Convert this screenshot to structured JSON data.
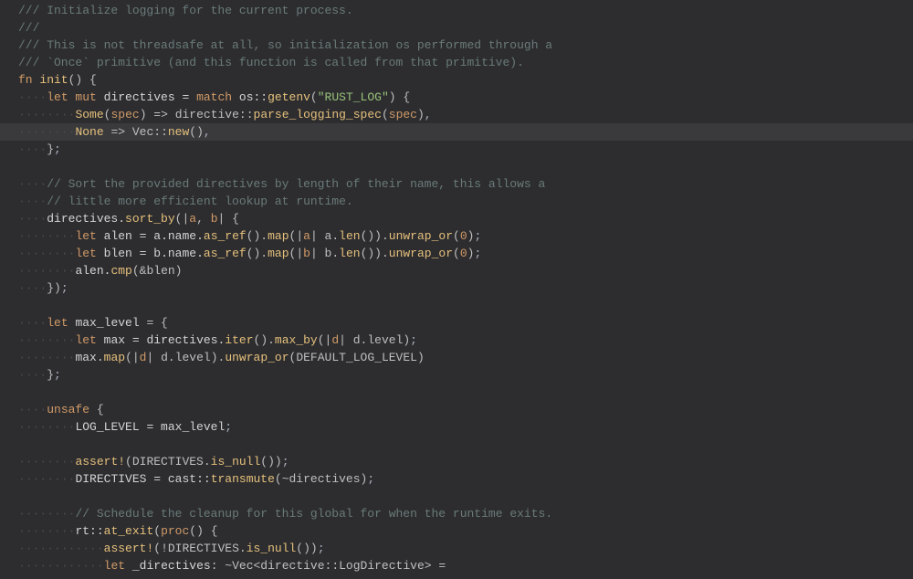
{
  "editor": {
    "lines": [
      {
        "spans": [
          {
            "t": "/// Initialize logging for the current process.",
            "c": "comment"
          }
        ],
        "ind": 0
      },
      {
        "spans": [
          {
            "t": "///",
            "c": "comment"
          }
        ],
        "ind": 0
      },
      {
        "spans": [
          {
            "t": "/// This is not threadsafe at all, so initialization os performed through a",
            "c": "comment"
          }
        ],
        "ind": 0
      },
      {
        "spans": [
          {
            "t": "/// `Once` primitive (and this function is called from that primitive).",
            "c": "comment"
          }
        ],
        "ind": 0
      },
      {
        "spans": [
          {
            "t": "fn ",
            "c": "kw"
          },
          {
            "t": "init",
            "c": "fnname"
          },
          {
            "t": "() {",
            "c": "punc"
          }
        ],
        "ind": 0
      },
      {
        "spans": [
          {
            "t": "let mut ",
            "c": "kw"
          },
          {
            "t": "directives ",
            "c": "ident"
          },
          {
            "t": "= ",
            "c": "op"
          },
          {
            "t": "match ",
            "c": "kw"
          },
          {
            "t": "os::",
            "c": "ident"
          },
          {
            "t": "getenv",
            "c": "fnname"
          },
          {
            "t": "(",
            "c": "punc"
          },
          {
            "t": "\"RUST_LOG\"",
            "c": "str"
          },
          {
            "t": ") {",
            "c": "punc"
          }
        ],
        "ind": 1
      },
      {
        "spans": [
          {
            "t": "Some",
            "c": "fnname"
          },
          {
            "t": "(",
            "c": "punc"
          },
          {
            "t": "spec",
            "c": "param"
          },
          {
            "t": ") => directive::",
            "c": "punc"
          },
          {
            "t": "parse_logging_spec",
            "c": "fnname"
          },
          {
            "t": "(",
            "c": "punc"
          },
          {
            "t": "spec",
            "c": "param"
          },
          {
            "t": ")",
            "c": "punc"
          },
          {
            "t": ",",
            "c": "semi"
          }
        ],
        "ind": 2
      },
      {
        "spans": [
          {
            "t": "None",
            "c": "fnname"
          },
          {
            "t": " => Vec::",
            "c": "punc"
          },
          {
            "t": "new",
            "c": "fnname"
          },
          {
            "t": "()",
            "c": "punc"
          },
          {
            "t": ",",
            "c": "semi"
          }
        ],
        "ind": 2,
        "hl": true
      },
      {
        "spans": [
          {
            "t": "}",
            "c": "punc"
          },
          {
            "t": ";",
            "c": "semi"
          }
        ],
        "ind": 1
      },
      {
        "spans": [],
        "ind": 0
      },
      {
        "spans": [
          {
            "t": "// Sort the provided directives by length of their name, this allows a",
            "c": "comment"
          }
        ],
        "ind": 1
      },
      {
        "spans": [
          {
            "t": "// little more efficient lookup at runtime.",
            "c": "comment"
          }
        ],
        "ind": 1
      },
      {
        "spans": [
          {
            "t": "directives.",
            "c": "ident"
          },
          {
            "t": "sort_by",
            "c": "fnname"
          },
          {
            "t": "(|",
            "c": "punc"
          },
          {
            "t": "a",
            "c": "param"
          },
          {
            "t": ", ",
            "c": "punc"
          },
          {
            "t": "b",
            "c": "param"
          },
          {
            "t": "| {",
            "c": "punc"
          }
        ],
        "ind": 1
      },
      {
        "spans": [
          {
            "t": "let ",
            "c": "kw"
          },
          {
            "t": "alen ",
            "c": "ident"
          },
          {
            "t": "= a.name.",
            "c": "ident"
          },
          {
            "t": "as_ref",
            "c": "fnname"
          },
          {
            "t": "().",
            "c": "punc"
          },
          {
            "t": "map",
            "c": "fnname"
          },
          {
            "t": "(|",
            "c": "punc"
          },
          {
            "t": "a",
            "c": "param"
          },
          {
            "t": "| a.",
            "c": "punc"
          },
          {
            "t": "len",
            "c": "fnname"
          },
          {
            "t": "()).",
            "c": "punc"
          },
          {
            "t": "unwrap_or",
            "c": "fnname"
          },
          {
            "t": "(",
            "c": "punc"
          },
          {
            "t": "0",
            "c": "num"
          },
          {
            "t": ")",
            "c": "punc"
          },
          {
            "t": ";",
            "c": "semi"
          }
        ],
        "ind": 2
      },
      {
        "spans": [
          {
            "t": "let ",
            "c": "kw"
          },
          {
            "t": "blen ",
            "c": "ident"
          },
          {
            "t": "= b.name.",
            "c": "ident"
          },
          {
            "t": "as_ref",
            "c": "fnname"
          },
          {
            "t": "().",
            "c": "punc"
          },
          {
            "t": "map",
            "c": "fnname"
          },
          {
            "t": "(|",
            "c": "punc"
          },
          {
            "t": "b",
            "c": "param"
          },
          {
            "t": "| b.",
            "c": "punc"
          },
          {
            "t": "len",
            "c": "fnname"
          },
          {
            "t": "()).",
            "c": "punc"
          },
          {
            "t": "unwrap_or",
            "c": "fnname"
          },
          {
            "t": "(",
            "c": "punc"
          },
          {
            "t": "0",
            "c": "num"
          },
          {
            "t": ")",
            "c": "punc"
          },
          {
            "t": ";",
            "c": "semi"
          }
        ],
        "ind": 2,
        "caret": 50
      },
      {
        "spans": [
          {
            "t": "alen.",
            "c": "ident"
          },
          {
            "t": "cmp",
            "c": "fnname"
          },
          {
            "t": "(&blen)",
            "c": "punc"
          }
        ],
        "ind": 2
      },
      {
        "spans": [
          {
            "t": "})",
            "c": "punc"
          },
          {
            "t": ";",
            "c": "semi"
          }
        ],
        "ind": 1
      },
      {
        "spans": [],
        "ind": 0
      },
      {
        "spans": [
          {
            "t": "let ",
            "c": "kw"
          },
          {
            "t": "max_level ",
            "c": "ident"
          },
          {
            "t": "= {",
            "c": "punc"
          }
        ],
        "ind": 1
      },
      {
        "spans": [
          {
            "t": "let ",
            "c": "kw"
          },
          {
            "t": "max ",
            "c": "ident"
          },
          {
            "t": "= directives.",
            "c": "ident"
          },
          {
            "t": "iter",
            "c": "fnname"
          },
          {
            "t": "().",
            "c": "punc"
          },
          {
            "t": "max_by",
            "c": "fnname"
          },
          {
            "t": "(|",
            "c": "punc"
          },
          {
            "t": "d",
            "c": "param"
          },
          {
            "t": "| d.level)",
            "c": "punc"
          },
          {
            "t": ";",
            "c": "semi"
          }
        ],
        "ind": 2
      },
      {
        "spans": [
          {
            "t": "max.",
            "c": "ident"
          },
          {
            "t": "map",
            "c": "fnname"
          },
          {
            "t": "(|",
            "c": "punc"
          },
          {
            "t": "d",
            "c": "param"
          },
          {
            "t": "| d.level).",
            "c": "punc"
          },
          {
            "t": "unwrap_or",
            "c": "fnname"
          },
          {
            "t": "(DEFAULT_LOG_LEVEL)",
            "c": "punc"
          }
        ],
        "ind": 2
      },
      {
        "spans": [
          {
            "t": "}",
            "c": "punc"
          },
          {
            "t": ";",
            "c": "semi"
          }
        ],
        "ind": 1
      },
      {
        "spans": [],
        "ind": 0
      },
      {
        "spans": [
          {
            "t": "unsafe ",
            "c": "kw"
          },
          {
            "t": "{",
            "c": "punc"
          }
        ],
        "ind": 1
      },
      {
        "spans": [
          {
            "t": "LOG_LEVEL ",
            "c": "ident"
          },
          {
            "t": "= max_level",
            "c": "ident"
          },
          {
            "t": ";",
            "c": "semi"
          }
        ],
        "ind": 2
      },
      {
        "spans": [],
        "ind": 0
      },
      {
        "spans": [
          {
            "t": "assert!",
            "c": "fnname"
          },
          {
            "t": "(DIRECTIVES.",
            "c": "punc"
          },
          {
            "t": "is_null",
            "c": "fnname"
          },
          {
            "t": "())",
            "c": "punc"
          },
          {
            "t": ";",
            "c": "semi"
          }
        ],
        "ind": 2
      },
      {
        "spans": [
          {
            "t": "DIRECTIVES ",
            "c": "ident"
          },
          {
            "t": "= cast::",
            "c": "ident"
          },
          {
            "t": "transmute",
            "c": "fnname"
          },
          {
            "t": "(~directives)",
            "c": "punc"
          },
          {
            "t": ";",
            "c": "semi"
          }
        ],
        "ind": 2
      },
      {
        "spans": [],
        "ind": 0
      },
      {
        "spans": [
          {
            "t": "// Schedule the cleanup for this global for when the runtime exits.",
            "c": "comment"
          }
        ],
        "ind": 2
      },
      {
        "spans": [
          {
            "t": "rt::",
            "c": "ident"
          },
          {
            "t": "at_exit",
            "c": "fnname"
          },
          {
            "t": "(",
            "c": "punc"
          },
          {
            "t": "proc",
            "c": "kw"
          },
          {
            "t": "() {",
            "c": "punc"
          }
        ],
        "ind": 2
      },
      {
        "spans": [
          {
            "t": "assert!",
            "c": "fnname"
          },
          {
            "t": "(!DIRECTIVES.",
            "c": "punc"
          },
          {
            "t": "is_null",
            "c": "fnname"
          },
          {
            "t": "())",
            "c": "punc"
          },
          {
            "t": ";",
            "c": "semi"
          }
        ],
        "ind": 3
      },
      {
        "spans": [
          {
            "t": "let ",
            "c": "kw"
          },
          {
            "t": "_directives",
            "c": "ident"
          },
          {
            "t": ": ~Vec<directive::LogDirective> =",
            "c": "punc"
          }
        ],
        "ind": 3
      }
    ],
    "indentGuide": "····"
  }
}
